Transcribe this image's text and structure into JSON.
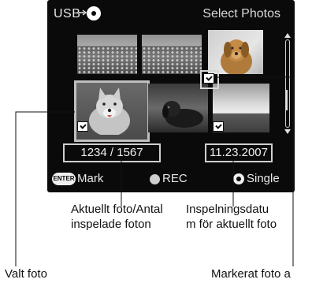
{
  "screen": {
    "source_label": "USB",
    "title": "Select Photos"
  },
  "thumbnails": [
    {
      "name": "flowers-1",
      "marked": false
    },
    {
      "name": "flowers-2",
      "marked": false
    },
    {
      "name": "dog-portrait",
      "marked": true
    },
    {
      "name": "dog-current",
      "marked": true,
      "selected": true
    },
    {
      "name": "dog-lying",
      "marked": false
    },
    {
      "name": "sky",
      "marked": true
    }
  ],
  "status": {
    "counter": "1234 / 1567",
    "date": "11.23.2007"
  },
  "buttons": {
    "enter_badge": "ENTER",
    "mark_label": "Mark",
    "rec_label": "REC",
    "single_label": "Single"
  },
  "callouts": {
    "current_line1": "Aktuellt foto/Antal",
    "current_line2": "inspelade foton",
    "date_line1": "Inspelningsdatu",
    "date_line2": "m för aktuellt foto",
    "selected": "Valt foto",
    "marked": "Markerat foto a"
  },
  "colors": {
    "screen_bg": "#0a0a0a",
    "screen_text": "#e8e8e8",
    "callout_text": "#111111"
  }
}
